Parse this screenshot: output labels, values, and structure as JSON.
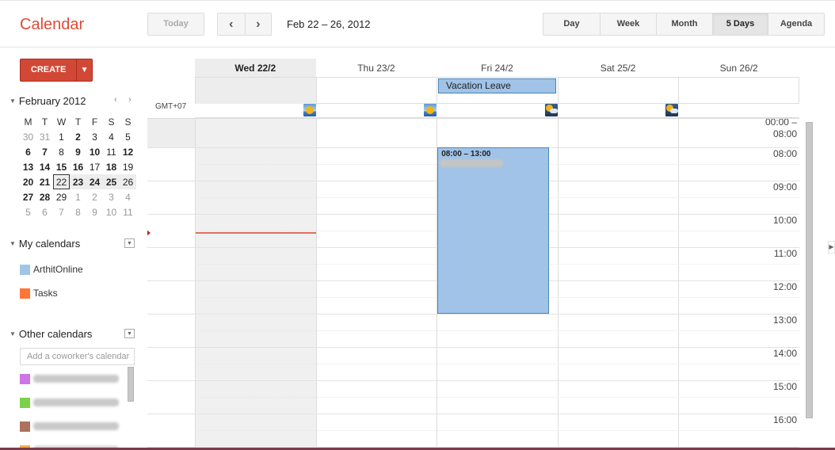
{
  "app": {
    "title": "Calendar"
  },
  "toolbar": {
    "today_label": "Today",
    "prev_icon": "‹",
    "next_icon": "›",
    "date_range": "Feb 22 – 26, 2012",
    "views": [
      {
        "label": "Day",
        "active": false
      },
      {
        "label": "Week",
        "active": false
      },
      {
        "label": "Month",
        "active": false
      },
      {
        "label": "5 Days",
        "active": true
      },
      {
        "label": "Agenda",
        "active": false
      }
    ]
  },
  "sidebar": {
    "create_label": "CREATE",
    "create_arrow": "▼",
    "mini_calendar": {
      "month_label": "February 2012",
      "prev": "‹",
      "next": "›",
      "weekdays": [
        "M",
        "T",
        "W",
        "T",
        "F",
        "S",
        "S"
      ],
      "weeks": [
        [
          {
            "d": "30",
            "out": true
          },
          {
            "d": "31",
            "out": true
          },
          {
            "d": "1"
          },
          {
            "d": "2",
            "bold": true
          },
          {
            "d": "3"
          },
          {
            "d": "4"
          },
          {
            "d": "5"
          }
        ],
        [
          {
            "d": "6",
            "bold": true
          },
          {
            "d": "7",
            "bold": true
          },
          {
            "d": "8"
          },
          {
            "d": "9",
            "bold": true
          },
          {
            "d": "10",
            "bold": true
          },
          {
            "d": "11"
          },
          {
            "d": "12",
            "bold": true
          }
        ],
        [
          {
            "d": "13",
            "bold": true
          },
          {
            "d": "14",
            "bold": true
          },
          {
            "d": "15",
            "bold": true
          },
          {
            "d": "16",
            "bold": true
          },
          {
            "d": "17"
          },
          {
            "d": "18",
            "bold": true
          },
          {
            "d": "19"
          }
        ],
        [
          {
            "d": "20",
            "bold": true
          },
          {
            "d": "21",
            "bold": true
          },
          {
            "d": "22",
            "today": true,
            "wk": true
          },
          {
            "d": "23",
            "bold": true,
            "wk": true
          },
          {
            "d": "24",
            "bold": true,
            "wk": true
          },
          {
            "d": "25",
            "bold": true,
            "wk": true
          },
          {
            "d": "26",
            "wk": true
          }
        ],
        [
          {
            "d": "27",
            "bold": true
          },
          {
            "d": "28",
            "bold": true
          },
          {
            "d": "29"
          },
          {
            "d": "1",
            "out": true
          },
          {
            "d": "2",
            "out": true
          },
          {
            "d": "3",
            "out": true
          },
          {
            "d": "4",
            "out": true
          }
        ],
        [
          {
            "d": "5",
            "out": true
          },
          {
            "d": "6",
            "out": true
          },
          {
            "d": "7",
            "out": true
          },
          {
            "d": "8",
            "out": true
          },
          {
            "d": "9",
            "out": true
          },
          {
            "d": "10",
            "out": true
          },
          {
            "d": "11",
            "out": true
          }
        ]
      ]
    },
    "my_calendars": {
      "heading": "My calendars",
      "items": [
        {
          "label": "ArthitOnline",
          "color": "#9fc6e7"
        },
        {
          "label": "Tasks",
          "color": "#ff7537"
        }
      ]
    },
    "other_calendars": {
      "heading": "Other calendars",
      "add_placeholder": "Add a coworker's calendar",
      "items": [
        {
          "color": "#cd74e6"
        },
        {
          "color": "#7bd148"
        },
        {
          "color": "#ac725e"
        },
        {
          "color": "#ffad46"
        }
      ]
    }
  },
  "calendar": {
    "timezone": "GMT+07",
    "early_label_1": "00:00 –",
    "early_label_2": "08:00",
    "days": [
      {
        "label": "Wed 22/2",
        "today": true,
        "weather": "sunny"
      },
      {
        "label": "Thu 23/2",
        "today": false,
        "weather": "sunny"
      },
      {
        "label": "Fri 24/2",
        "today": false,
        "weather": "cloudy"
      },
      {
        "label": "Sat 25/2",
        "today": false,
        "weather": "cloudy"
      },
      {
        "label": "Sun 26/2",
        "today": false,
        "weather": ""
      }
    ],
    "hours": [
      "08:00",
      "09:00",
      "10:00",
      "11:00",
      "12:00",
      "13:00",
      "14:00",
      "15:00",
      "16:00"
    ],
    "allday_events": [
      {
        "title": "Vacation Leave",
        "day": "Fri 24/2",
        "color": "#a0c3e7"
      }
    ],
    "events": [
      {
        "time": "08:00 – 13:00",
        "day": "Fri 24/2",
        "start": "08:00",
        "end": "13:00",
        "color": "#a0c3e7"
      }
    ],
    "current_time": "10:30"
  }
}
